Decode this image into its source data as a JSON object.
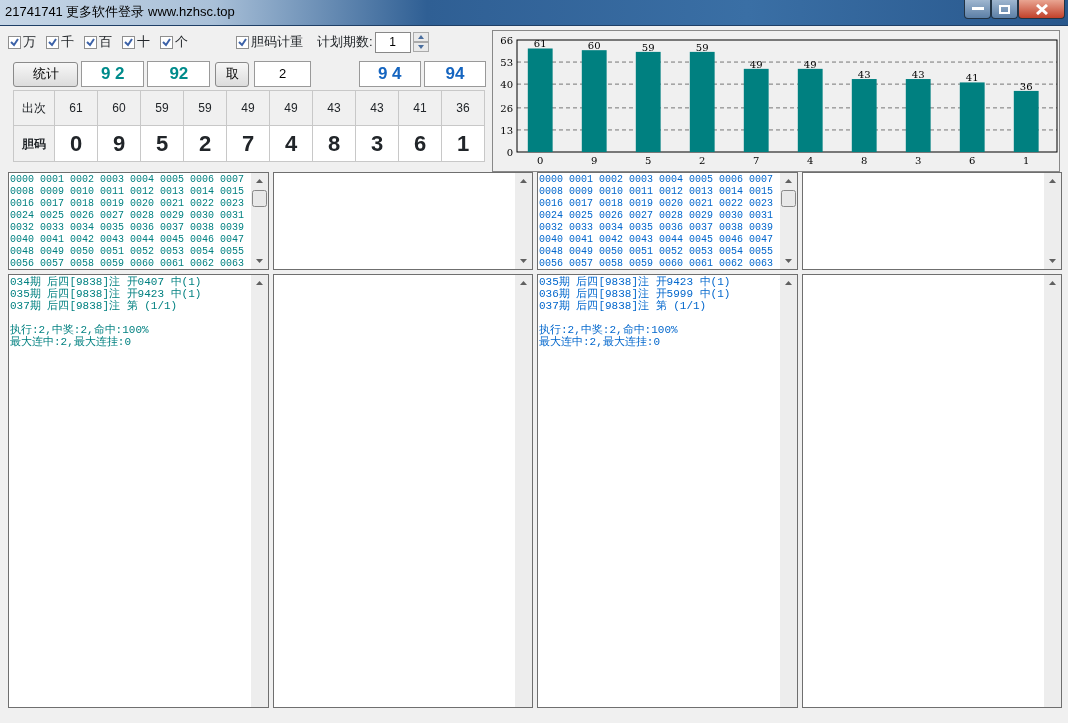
{
  "window": {
    "title": "21741741 更多软件登录 www.hzhsc.top"
  },
  "options": {
    "checkboxes": [
      {
        "label": "万",
        "checked": true
      },
      {
        "label": "千",
        "checked": true
      },
      {
        "label": "百",
        "checked": true
      },
      {
        "label": "十",
        "checked": true
      },
      {
        "label": "个",
        "checked": true
      },
      {
        "label": "胆码计重",
        "checked": true
      }
    ],
    "plan_periods": {
      "label": "计划期数:",
      "value": "1"
    }
  },
  "actions": {
    "stats_button": "统计",
    "result_fields": [
      "9 2",
      "92"
    ],
    "take_button": "取",
    "take_value": "2",
    "right_fields": [
      "9 4",
      "94"
    ]
  },
  "table": {
    "rows": [
      {
        "header": "出次",
        "cells": [
          "61",
          "60",
          "59",
          "59",
          "49",
          "49",
          "43",
          "43",
          "41",
          "36"
        ]
      },
      {
        "header": "胆码",
        "cells": [
          "0",
          "9",
          "5",
          "2",
          "7",
          "4",
          "8",
          "3",
          "6",
          "1"
        ]
      }
    ]
  },
  "chart": {
    "chart_data": {
      "type": "bar",
      "categories": [
        "0",
        "9",
        "5",
        "2",
        "7",
        "4",
        "8",
        "3",
        "6",
        "1"
      ],
      "series": [
        {
          "color": "#008080",
          "values": [
            61,
            60,
            59,
            59,
            49,
            49,
            43,
            43,
            41,
            36
          ]
        }
      ],
      "ylim": [
        0,
        66
      ],
      "yticks": [
        0,
        13,
        26,
        40,
        53,
        66
      ],
      "data_labels": true,
      "grid": true
    }
  },
  "panels": [
    {
      "kind": "filled",
      "color": "#008080",
      "numbers": [
        "0000 0001 0002 0003 0004 0005 0006 0007",
        "0008 0009 0010 0011 0012 0013 0014 0015",
        "0016 0017 0018 0019 0020 0021 0022 0023",
        "0024 0025 0026 0027 0028 0029 0030 0031",
        "0032 0033 0034 0035 0036 0037 0038 0039",
        "0040 0041 0042 0043 0044 0045 0046 0047",
        "0048 0049 0050 0051 0052 0053 0054 0055",
        "0056 0057 0058 0059 0060 0061 0062 0063"
      ],
      "log": [
        "034期 后四[9838]注 开0407 中(1)",
        "035期 后四[9838]注 开9423 中(1)",
        "037期 后四[9838]注 第 (1/1)"
      ],
      "summary": [
        "执行:2,中奖:2,命中:100%",
        "最大连中:2,最大连挂:0"
      ]
    },
    {
      "kind": "empty"
    },
    {
      "kind": "filled",
      "color": "#0066cc",
      "numbers": [
        "0000 0001 0002 0003 0004 0005 0006 0007",
        "0008 0009 0010 0011 0012 0013 0014 0015",
        "0016 0017 0018 0019 0020 0021 0022 0023",
        "0024 0025 0026 0027 0028 0029 0030 0031",
        "0032 0033 0034 0035 0036 0037 0038 0039",
        "0040 0041 0042 0043 0044 0045 0046 0047",
        "0048 0049 0050 0051 0052 0053 0054 0055",
        "0056 0057 0058 0059 0060 0061 0062 0063"
      ],
      "log": [
        "035期 后四[9838]注 开9423 中(1)",
        "036期 后四[9838]注 开5999 中(1)",
        "037期 后四[9838]注 第 (1/1)"
      ],
      "summary": [
        "执行:2,中奖:2,命中:100%",
        "最大连中:2,最大连挂:0"
      ]
    },
    {
      "kind": "empty"
    }
  ]
}
